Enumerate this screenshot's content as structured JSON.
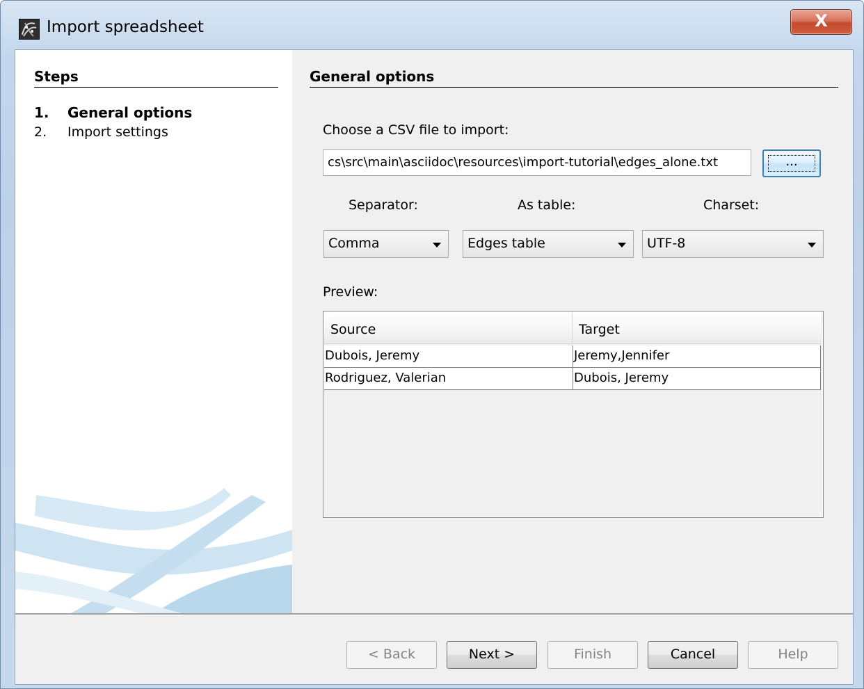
{
  "window": {
    "title": "Import spreadsheet",
    "close_label": "X"
  },
  "steps": {
    "heading": "Steps",
    "items": [
      {
        "number": "1.",
        "label": "General options",
        "active": true
      },
      {
        "number": "2.",
        "label": "Import settings",
        "active": false
      }
    ]
  },
  "general": {
    "heading": "General options",
    "choose_label": "Choose a CSV file to import:",
    "file_path": "cs\\src\\main\\asciidoc\\resources\\import-tutorial\\edges_alone.txt",
    "browse_label": "...",
    "separator_label": "Separator:",
    "as_table_label": "As table:",
    "charset_label": "Charset:",
    "separator_value": "Comma",
    "as_table_value": "Edges table",
    "charset_value": "UTF-8",
    "preview_label": "Preview:"
  },
  "preview": {
    "columns": [
      "Source",
      "Target"
    ],
    "rows": [
      [
        "Dubois, Jeremy",
        "Jeremy,Jennifer"
      ],
      [
        "Rodriguez, Valerian",
        "Dubois, Jeremy"
      ]
    ]
  },
  "buttons": {
    "back": "< Back",
    "next": "Next >",
    "finish": "Finish",
    "cancel": "Cancel",
    "help": "Help"
  },
  "colors": {
    "close_button": "#c44a2c",
    "focus_border": "#3c7fb1",
    "disabled_text": "#838383"
  }
}
